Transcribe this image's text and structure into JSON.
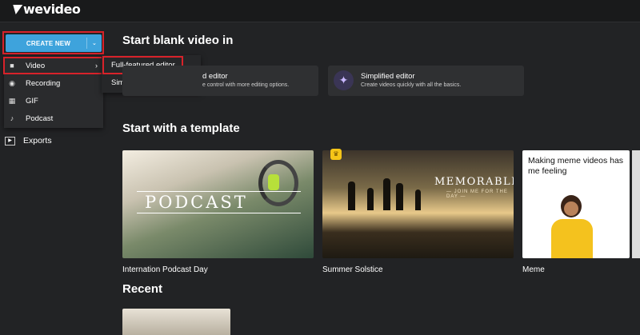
{
  "app": {
    "logo": "wevideo"
  },
  "sidebar": {
    "create_new": {
      "label": "CREATE NEW",
      "chevron": "⌄"
    },
    "menu": [
      {
        "label": "Video",
        "icon": "video-camera-icon",
        "arrow": "›"
      },
      {
        "label": "Recording",
        "icon": "record-icon"
      },
      {
        "label": "GIF",
        "icon": "gif-icon"
      },
      {
        "label": "Podcast",
        "icon": "music-note-icon"
      }
    ],
    "video_submenu": [
      "Full-featured editor",
      "Simplified editor"
    ],
    "exports": {
      "label": "Exports",
      "icon": "exports-icon"
    }
  },
  "main": {
    "blank_heading": "Start blank video in",
    "editors": [
      {
        "title": "d editor",
        "desc": "e control with more editing options."
      },
      {
        "title": "Simplified editor",
        "desc": "Create videos quickly with all the basics.",
        "icon": "sparkle-icon"
      }
    ],
    "template_heading": "Start with a template",
    "templates": [
      {
        "caption": "Internation Podcast Day",
        "thumb_text": "PODCAST"
      },
      {
        "caption": "Summer Solstice",
        "thumb_text": "MEMORABLE",
        "thumb_sub": "— JOIN ME FOR THE DAY —",
        "badge": "crown-icon"
      },
      {
        "caption": "Meme",
        "thumb_text": "Making meme videos has me feeling"
      }
    ],
    "recent_heading": "Recent"
  },
  "colors": {
    "accent": "#3ea3dc",
    "highlight": "#d8222a",
    "bg": "#222325"
  }
}
